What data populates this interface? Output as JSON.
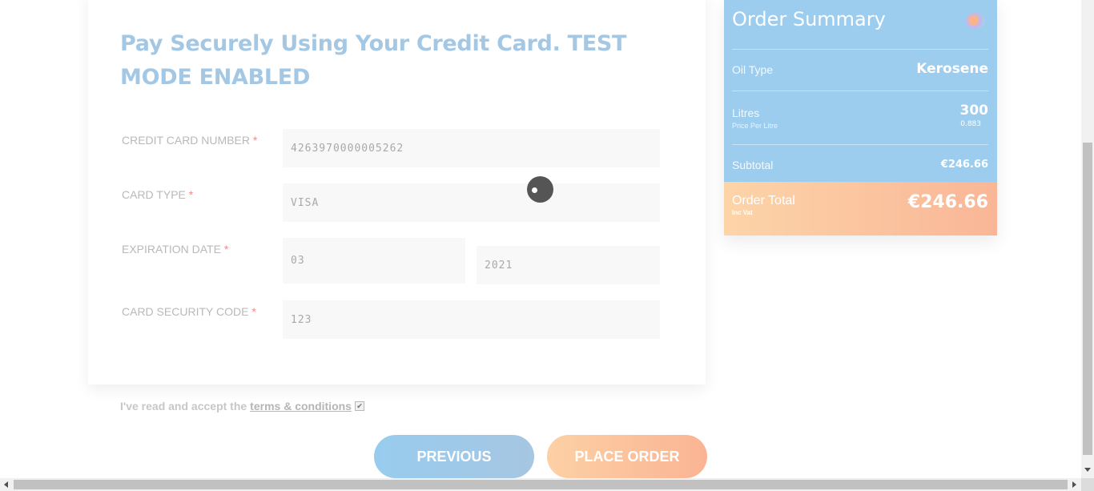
{
  "payment": {
    "title": "Pay Securely Using Your Credit Card. TEST MODE ENABLED",
    "required_mark": "*",
    "card_number_label": "CREDIT CARD NUMBER",
    "card_number_value": "4263970000005262",
    "card_type_label": "CARD TYPE",
    "card_type_value": "VISA",
    "expiration_label": "EXPIRATION DATE",
    "expiration_month": "03",
    "expiration_year": "2021",
    "security_code_label": "CARD SECURITY CODE",
    "security_code_value": "123"
  },
  "terms": {
    "text": "I've read and accept the",
    "link": "terms & conditions",
    "checked": true,
    "check_glyph": "✔"
  },
  "buttons": {
    "previous": "PREVIOUS",
    "place_order": "PLACE ORDER"
  },
  "summary": {
    "title": "Order Summary",
    "oil_type_label": "Oil Type",
    "oil_type_value": "Kerosene",
    "litres_label": "Litres",
    "litres_value": "300",
    "price_per_litre_label": "Price Per Litre",
    "price_per_litre_value": "0.883",
    "subtotal_label": "Subtotal",
    "subtotal_value": "€246.66",
    "total_label": "Order Total",
    "total_sub": "Inc Vat",
    "total_value": "€246.66"
  },
  "colors": {
    "title_blue": "#a4c8e4",
    "summary_blue": "#9ccdee",
    "accent_orange": "#f9b697",
    "required_red": "#f08a8a"
  },
  "icons": {
    "logo": "company-logo-icon",
    "spinner": "loading-spinner-icon",
    "checkbox": "checkbox-checked-icon"
  }
}
